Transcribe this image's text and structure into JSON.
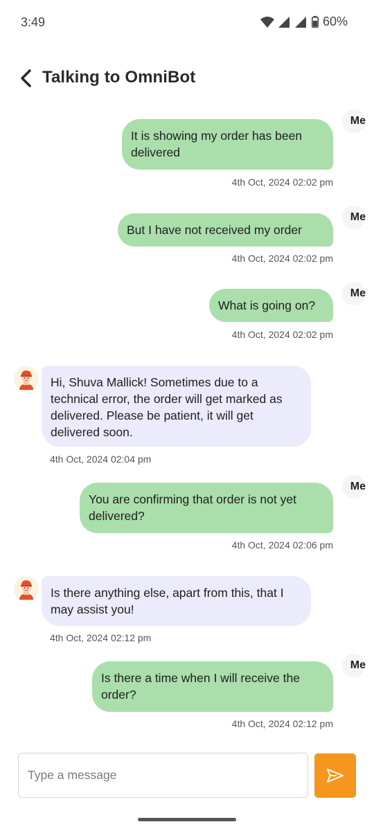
{
  "status_bar": {
    "time": "3:49",
    "battery": "60%"
  },
  "header": {
    "title": "Talking to OmniBot"
  },
  "me_label": "Me",
  "messages": [
    {
      "from": "me",
      "text": "It is showing my order has been delivered",
      "time": "4th Oct, 2024 02:02 pm"
    },
    {
      "from": "me",
      "text": "But I have not received my order",
      "time": "4th Oct, 2024 02:02 pm"
    },
    {
      "from": "me",
      "text": "What is going on?",
      "time": "4th Oct, 2024 02:02 pm"
    },
    {
      "from": "bot",
      "text": "Hi, Shuva Mallick! Sometimes due to a technical error, the order will get marked as delivered. Please be patient, it will get delivered soon.",
      "time": "4th Oct, 2024 02:04 pm"
    },
    {
      "from": "me",
      "text": "You are confirming that order is not yet delivered?",
      "time": "4th Oct, 2024 02:06 pm"
    },
    {
      "from": "bot",
      "text": "Is there anything else, apart from this, that I may assist you!",
      "time": "4th Oct, 2024 02:12 pm"
    },
    {
      "from": "me",
      "text": "Is there a time when I will receive the order?",
      "time": "4th Oct, 2024 02:12 pm"
    }
  ],
  "composer": {
    "placeholder": "Type a message"
  },
  "colors": {
    "me_bubble": "#aadfac",
    "bot_bubble": "#ecebfb",
    "send_button": "#f5961f"
  }
}
